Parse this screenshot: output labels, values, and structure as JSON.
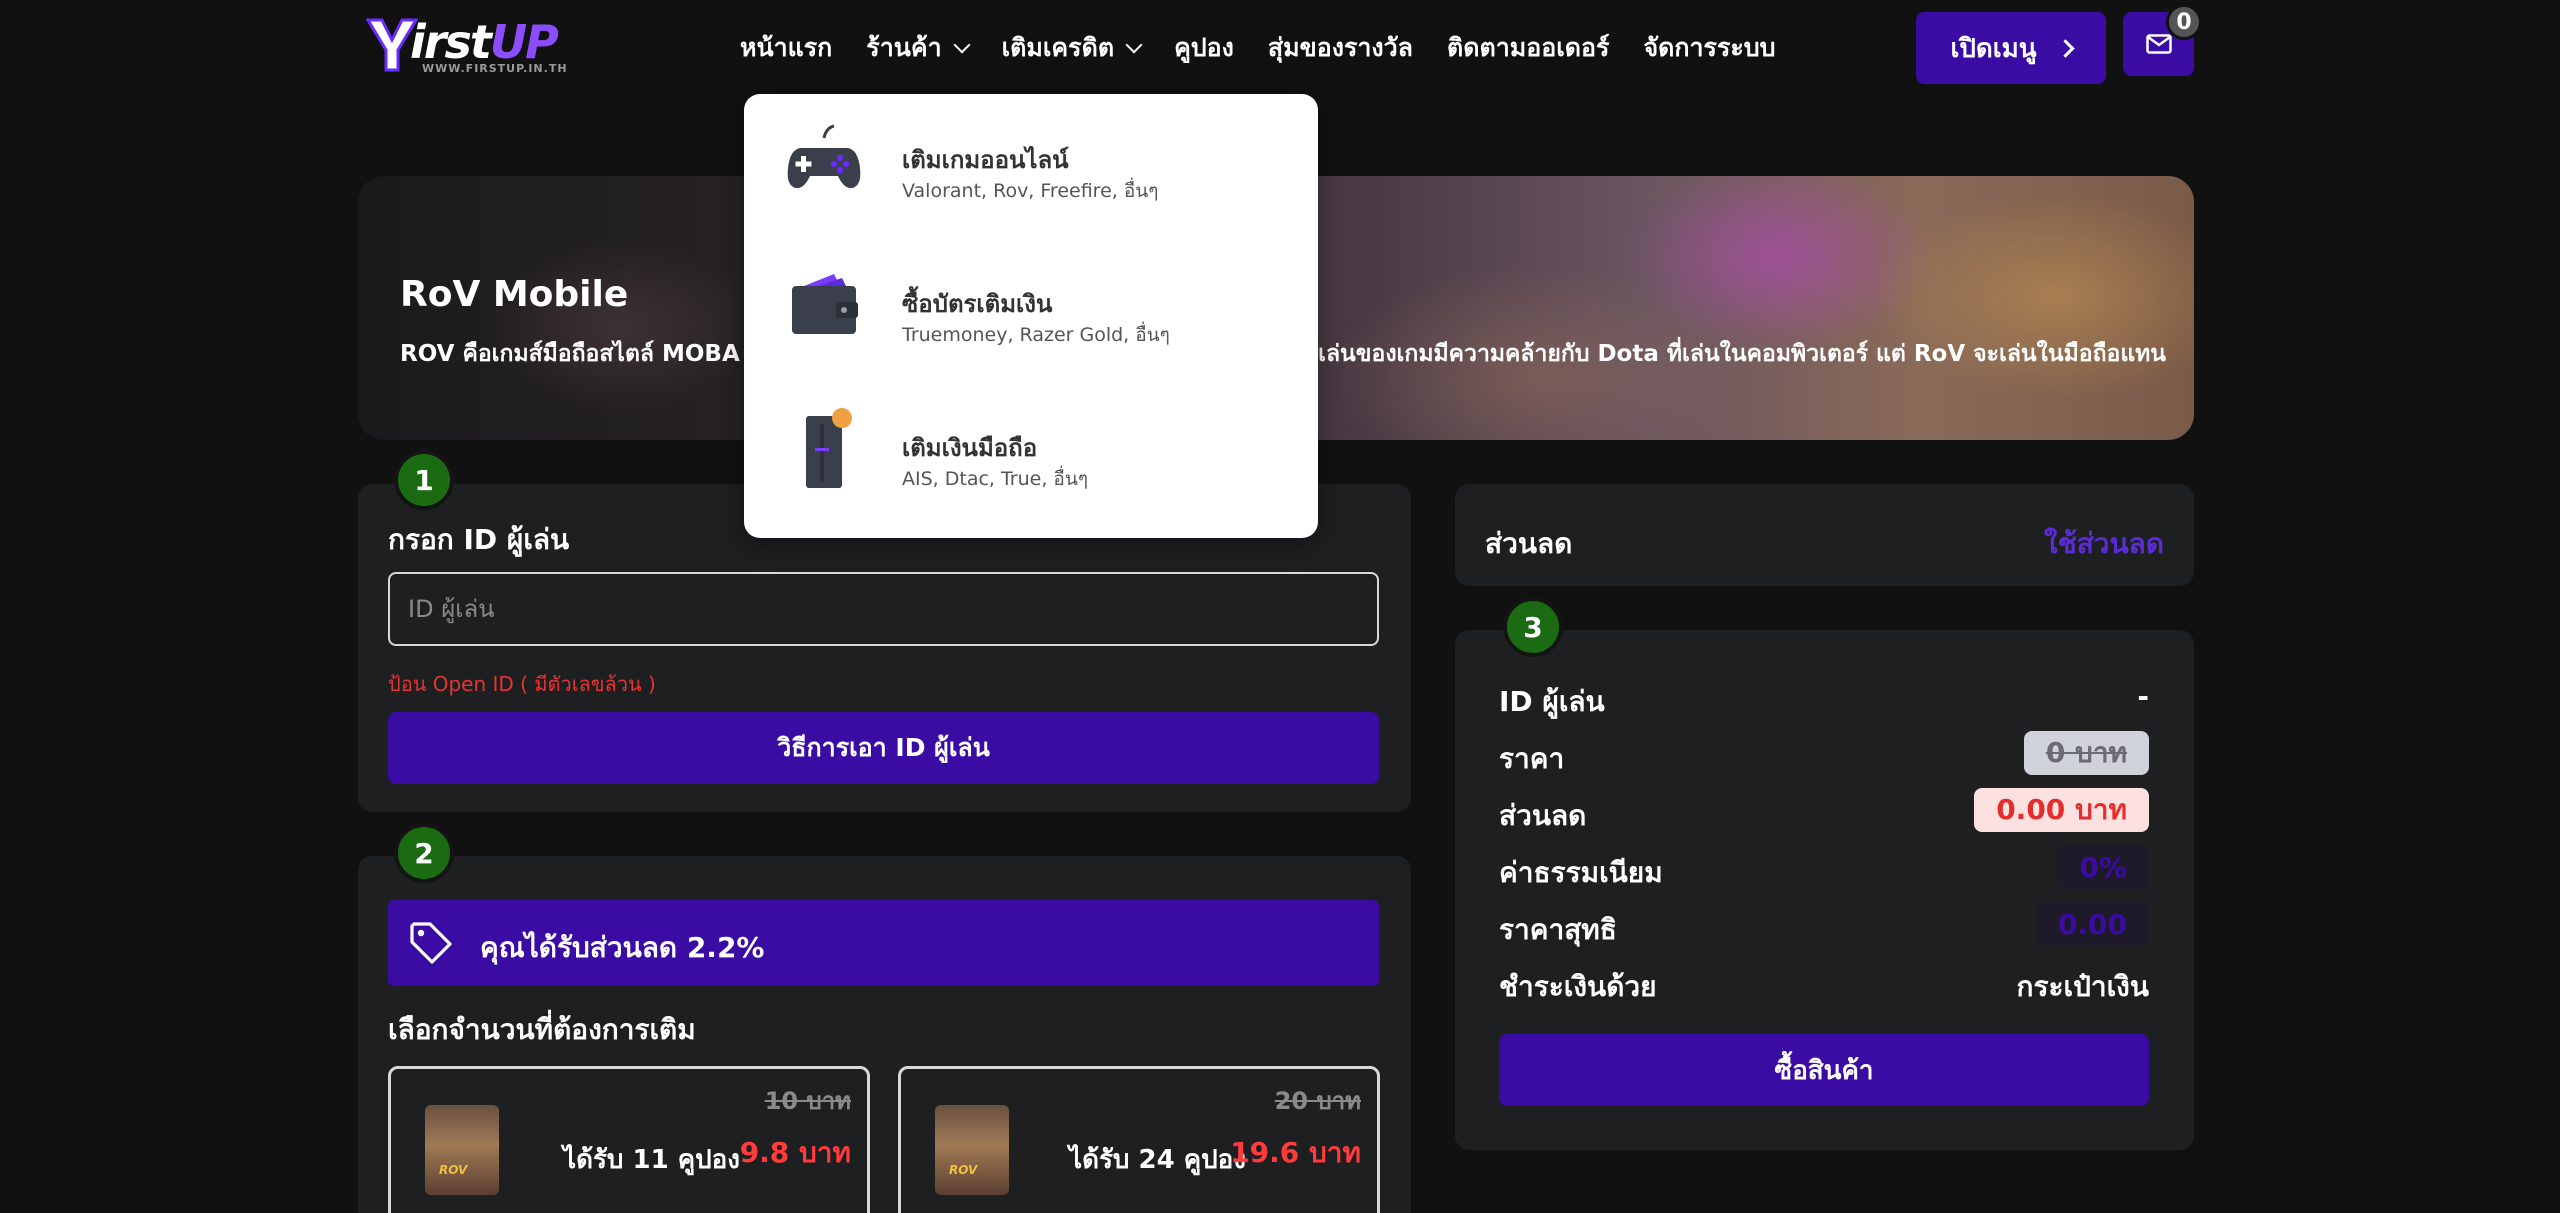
{
  "navbar": {
    "logo_text_main": "irst",
    "logo_text_accent": "UP",
    "logo_subtext": "WWW.FIRSTUP.IN.TH",
    "items": [
      {
        "label": "หน้าแรก",
        "has_dropdown": false
      },
      {
        "label": "ร้านค้า",
        "has_dropdown": true
      },
      {
        "label": "เติมเครดิต",
        "has_dropdown": true
      },
      {
        "label": "คูปอง",
        "has_dropdown": false
      },
      {
        "label": "สุ่มของรางวัล",
        "has_dropdown": false
      },
      {
        "label": "ติดตามออเดอร์",
        "has_dropdown": false
      },
      {
        "label": "จัดการระบบ",
        "has_dropdown": false
      }
    ],
    "menu_button_label": "เปิดเมนู",
    "mail_badge_count": "0",
    "accent_color": "#3a0ca3"
  },
  "dropdown": {
    "items": [
      {
        "title": "เติมเกมออนไลน์",
        "subtitle": "Valorant, Rov, Freefire, อื่นๆ",
        "icon": "gamepad-icon"
      },
      {
        "title": "ซื้อบัตรเติมเงิน",
        "subtitle": "Truemoney, Razer Gold, อื่นๆ",
        "icon": "wallet-icon"
      },
      {
        "title": "เติมเงินมือถือ",
        "subtitle": "AIS, Dtac, True, อื่นๆ",
        "icon": "phone-icon"
      }
    ]
  },
  "banner": {
    "title": "RoV Mobile",
    "description": "ROV คือเกมส์มือถือสไตล์ MOBA จ                                                                    รเล่นของเกมมีความคล้ายกับ Dota ที่เล่นในคอมพิวเตอร์ แต่ RoV จะเล่นในมือถือแทน"
  },
  "step1": {
    "number": "1",
    "title": "กรอก ID ผู้เล่น",
    "input_placeholder": "ID ผู้เล่น",
    "input_value": "",
    "hint": "ป้อน Open ID ( มีตัวเลขล้วน )",
    "howto_button": "วิธีการเอา ID ผู้เล่น"
  },
  "step2": {
    "number": "2",
    "discount_text": "คุณได้รับส่วนลด 2.2%",
    "amount_title": "เลือกจำนวนที่ต้องการเติม",
    "packages": [
      {
        "label": "ได้รับ 11 คูปอง",
        "old_price": "10 บาท",
        "price": "9.8 บาท",
        "image_text": "ROV"
      },
      {
        "label": "ได้รับ 24 คูปอง",
        "old_price": "20 บาท",
        "price": "19.6 บาท",
        "image_text": "ROV"
      }
    ]
  },
  "discount_panel": {
    "title": "ส่วนลด",
    "link": "ใช้ส่วนลด"
  },
  "summary": {
    "number": "3",
    "rows": [
      {
        "label": "ID ผู้เล่น",
        "value": "-"
      },
      {
        "label": "ราคา",
        "value": "0 บาท"
      },
      {
        "label": "ส่วนลด",
        "value": "0.00 บาท"
      },
      {
        "label": "ค่าธรรมเนียม",
        "value": "0%"
      },
      {
        "label": "ราคาสุทธิ",
        "value": "0.00"
      },
      {
        "label": "ชำระเงินด้วย",
        "value": "กระเป๋าเงิน"
      }
    ],
    "buy_button": "ซื้อสินค้า"
  }
}
